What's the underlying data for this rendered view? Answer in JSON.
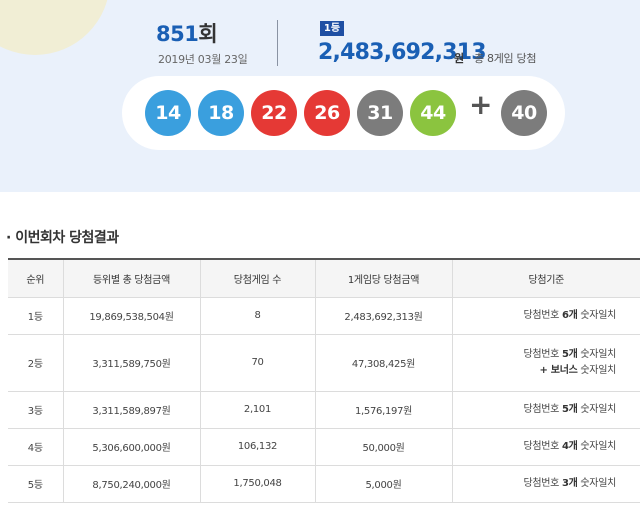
{
  "draw": {
    "number": "851",
    "number_unit": "회",
    "date": "2019년 03월 23일"
  },
  "first_prize": {
    "badge": "1등",
    "amount": "2,483,692,313",
    "amount_unit": "원",
    "winners_text": "총 8게임 당첨"
  },
  "balls": [
    {
      "number": "14",
      "color": "#3a9fde"
    },
    {
      "number": "18",
      "color": "#3a9fde"
    },
    {
      "number": "22",
      "color": "#e53935"
    },
    {
      "number": "26",
      "color": "#e53935"
    },
    {
      "number": "31",
      "color": "#7c7c7c"
    },
    {
      "number": "44",
      "color": "#8bc43f"
    }
  ],
  "plus_sign": "+",
  "bonus_ball": {
    "number": "40",
    "color": "#7c7c7c"
  },
  "section_title": "· 이번회차 당첨결과",
  "table": {
    "headers": [
      "순위",
      "등위별 총 당첨금액",
      "당첨게임 수",
      "1게임당 당첨금액",
      "당첨기준"
    ],
    "rows": [
      {
        "rank": "1등",
        "total": "19,869,538,504원",
        "games": "8",
        "per_game": "2,483,692,313원",
        "crit_pre": "당첨번호 ",
        "crit_bold": "6개",
        "crit_post": " 숫자일치",
        "crit_line2": ""
      },
      {
        "rank": "2등",
        "total": "3,311,589,750원",
        "games": "70",
        "per_game": "47,308,425원",
        "crit_pre": "당첨번호 ",
        "crit_bold": "5개",
        "crit_post": " 숫자일치",
        "crit_line2_bold": "+ 보너스",
        "crit_line2": " 숫자일치"
      },
      {
        "rank": "3등",
        "total": "3,311,589,897원",
        "games": "2,101",
        "per_game": "1,576,197원",
        "crit_pre": "당첨번호 ",
        "crit_bold": "5개",
        "crit_post": " 숫자일치",
        "crit_line2": ""
      },
      {
        "rank": "4등",
        "total": "5,306,600,000원",
        "games": "106,132",
        "per_game": "50,000원",
        "crit_pre": "당첨번호 ",
        "crit_bold": "4개",
        "crit_post": " 숫자일치",
        "crit_line2": ""
      },
      {
        "rank": "5등",
        "total": "8,750,240,000원",
        "games": "1,750,048",
        "per_game": "5,000원",
        "crit_pre": "당첨번호 ",
        "crit_bold": "3개",
        "crit_post": " 숫자일치",
        "crit_line2": ""
      }
    ]
  }
}
